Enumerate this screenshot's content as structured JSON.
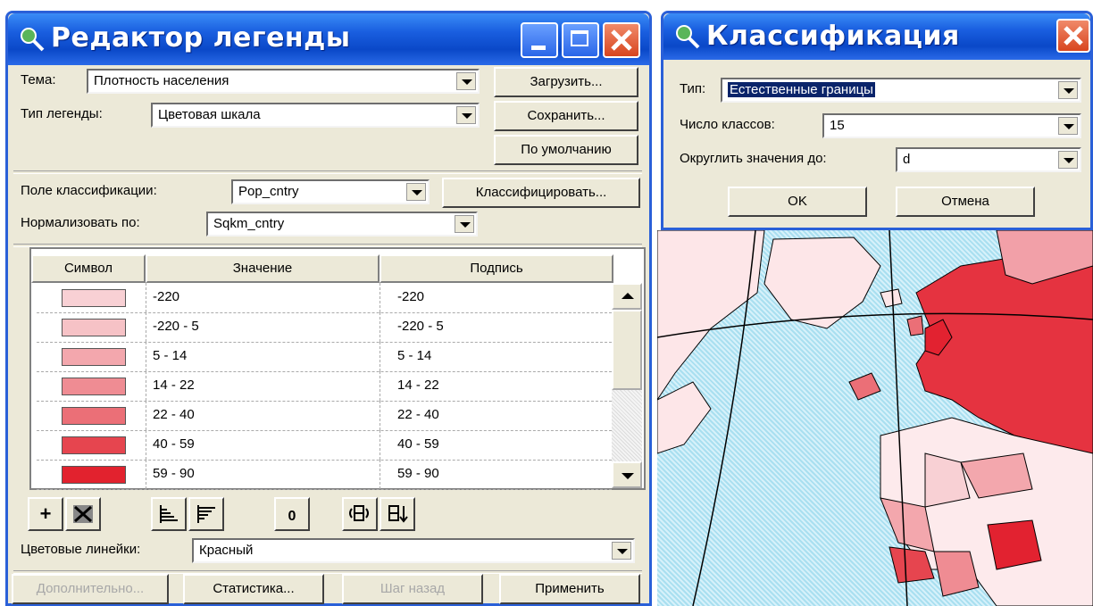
{
  "legend_editor": {
    "title": "Редактор легенды",
    "theme_label": "Тема:",
    "theme_value": "Плотность населения",
    "legend_type_label": "Тип легенды:",
    "legend_type_value": "Цветовая шкала",
    "load_button": "Загрузить...",
    "save_button": "Сохранить...",
    "default_button": "По умолчанию",
    "class_field_label": "Поле классификации:",
    "class_field_value": "Pop_cntry",
    "classify_button": "Классифицировать...",
    "normalize_label": "Нормализовать по:",
    "normalize_value": "Sqkm_cntry",
    "table": {
      "headers": [
        "Символ",
        "Значение",
        "Подпись"
      ],
      "rows": [
        {
          "value": "-220",
          "label": "-220",
          "color": "#f8d0d4"
        },
        {
          "value": "-220 - 5",
          "label": "-220 - 5",
          "color": "#f6c2c6"
        },
        {
          "value": "5 - 14",
          "label": "5 - 14",
          "color": "#f3a7ad"
        },
        {
          "value": "14 - 22",
          "label": "14 - 22",
          "color": "#ef8c93"
        },
        {
          "value": "22 - 40",
          "label": "22 - 40",
          "color": "#eb6f77"
        },
        {
          "value": "40 - 59",
          "label": "40 - 59",
          "color": "#e6454f"
        },
        {
          "value": "59 - 90",
          "label": "59 - 90",
          "color": "#e2222e"
        }
      ]
    },
    "color_ramp_label": "Цветовые линейки:",
    "color_ramp_value": "Красный",
    "advanced_button": "Дополнительно...",
    "stats_button": "Статистика...",
    "undo_button": "Шаг назад",
    "apply_button": "Применить",
    "toolbar": {
      "add_icon": "plus-icon",
      "delete_icon": "delete-icon",
      "sort_asc_icon": "sort-ascending-icon",
      "sort_desc_icon": "sort-descending-icon",
      "null_label": "0",
      "null_icon": "null-value-icon",
      "reverse_icon": "reverse-symbols-icon",
      "sort_icon": "sort-icon"
    }
  },
  "classification": {
    "title": "Классификация",
    "type_label": "Тип:",
    "type_value": "Естественные границы",
    "classes_label": "Число классов:",
    "classes_value": "15",
    "round_label": "Округлить значения до:",
    "round_value": "d",
    "ok_button": "OK",
    "cancel_button": "Отмена"
  },
  "colors": {
    "titlebar": "#0a48c8",
    "window_bg": "#ece9d8",
    "map_sea": "#bfe8f6"
  }
}
